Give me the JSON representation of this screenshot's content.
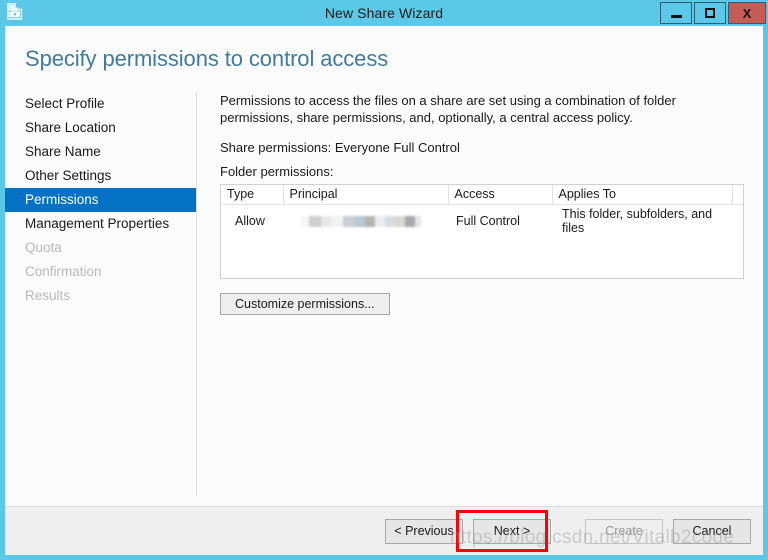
{
  "window": {
    "title": "New Share Wizard",
    "icon": "share-wizard-icon",
    "accent_color": "#5bc8e8",
    "close_color": "#c75c55",
    "controls": {
      "minimize": "minimize-icon",
      "maximize": "maximize-icon",
      "close": "X"
    }
  },
  "page": {
    "heading": "Specify permissions to control access",
    "heading_color": "#3f7c9e"
  },
  "sidebar": {
    "selected_color": "#0472c4",
    "items": [
      {
        "label": "Select Profile",
        "state": "done"
      },
      {
        "label": "Share Location",
        "state": "done"
      },
      {
        "label": "Share Name",
        "state": "done"
      },
      {
        "label": "Other Settings",
        "state": "done"
      },
      {
        "label": "Permissions",
        "state": "selected"
      },
      {
        "label": "Management Properties",
        "state": "enabled"
      },
      {
        "label": "Quota",
        "state": "disabled"
      },
      {
        "label": "Confirmation",
        "state": "disabled"
      },
      {
        "label": "Results",
        "state": "disabled"
      }
    ]
  },
  "main": {
    "intro": "Permissions to access the files on a share are set using a combination of folder permissions, share permissions, and, optionally, a central access policy.",
    "share_permissions_label": "Share permissions: Everyone Full Control",
    "folder_permissions_label": "Folder permissions:",
    "table": {
      "columns": [
        "Type",
        "Principal",
        "Access",
        "Applies To",
        ""
      ],
      "rows": [
        {
          "type": "Allow",
          "principal": "",
          "principal_redacted": true,
          "access": "Full Control",
          "applies_to": "This folder, subfolders, and files",
          "extra": ""
        }
      ]
    },
    "customize_button": "Customize permissions..."
  },
  "footer": {
    "previous": "< Previous",
    "next": "Next >",
    "create": "Create",
    "cancel": "Cancel",
    "create_disabled": true,
    "next_highlight_color": "#ff0000"
  },
  "overlay": {
    "watermark": "https://blog.csdn.net/Vitalb2code"
  }
}
